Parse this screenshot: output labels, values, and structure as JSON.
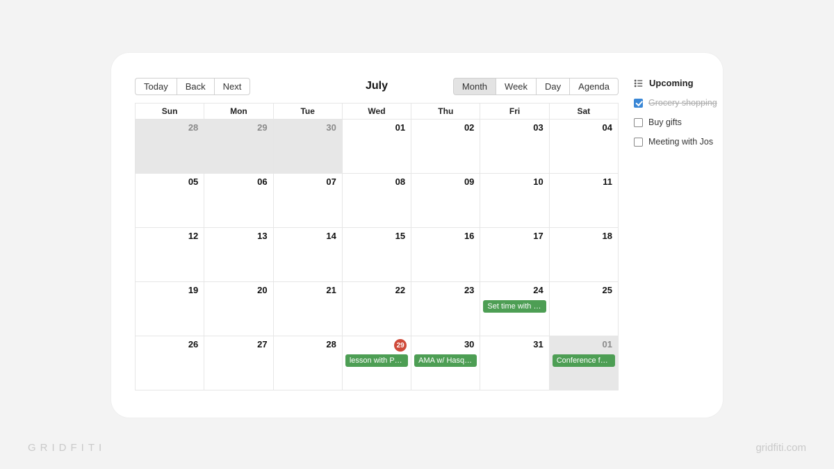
{
  "nav": {
    "today": "Today",
    "back": "Back",
    "next": "Next"
  },
  "title": "July",
  "views": {
    "month": "Month",
    "week": "Week",
    "day": "Day",
    "agenda": "Agenda",
    "active": "month"
  },
  "daysOfWeek": [
    "Sun",
    "Mon",
    "Tue",
    "Wed",
    "Thu",
    "Fri",
    "Sat"
  ],
  "cells": [
    {
      "n": "28",
      "off": true
    },
    {
      "n": "29",
      "off": true
    },
    {
      "n": "30",
      "off": true
    },
    {
      "n": "01"
    },
    {
      "n": "02"
    },
    {
      "n": "03"
    },
    {
      "n": "04"
    },
    {
      "n": "05"
    },
    {
      "n": "06"
    },
    {
      "n": "07"
    },
    {
      "n": "08"
    },
    {
      "n": "09"
    },
    {
      "n": "10"
    },
    {
      "n": "11"
    },
    {
      "n": "12"
    },
    {
      "n": "13"
    },
    {
      "n": "14"
    },
    {
      "n": "15"
    },
    {
      "n": "16"
    },
    {
      "n": "17"
    },
    {
      "n": "18"
    },
    {
      "n": "19"
    },
    {
      "n": "20"
    },
    {
      "n": "21"
    },
    {
      "n": "22"
    },
    {
      "n": "23"
    },
    {
      "n": "24",
      "event": "Set time with Li…"
    },
    {
      "n": "25"
    },
    {
      "n": "26"
    },
    {
      "n": "27"
    },
    {
      "n": "28"
    },
    {
      "n": "29",
      "today": true,
      "event": "lesson with Prof…"
    },
    {
      "n": "30",
      "event": "AMA w/ Hasque…"
    },
    {
      "n": "31"
    },
    {
      "n": "01",
      "off": true,
      "event": "Conference for …"
    }
  ],
  "upcoming": {
    "title": "Upcoming",
    "items": [
      {
        "label": "Grocery shopping",
        "done": true
      },
      {
        "label": "Buy gifts",
        "done": false
      },
      {
        "label": "Meeting with Jos",
        "done": false
      }
    ]
  },
  "watermark": {
    "left": "GRIDFITI",
    "right": "gridfiti.com"
  },
  "colors": {
    "event": "#4d9e54",
    "todayBadge": "#cf4a3a",
    "checkbox": "#3a87d6"
  }
}
